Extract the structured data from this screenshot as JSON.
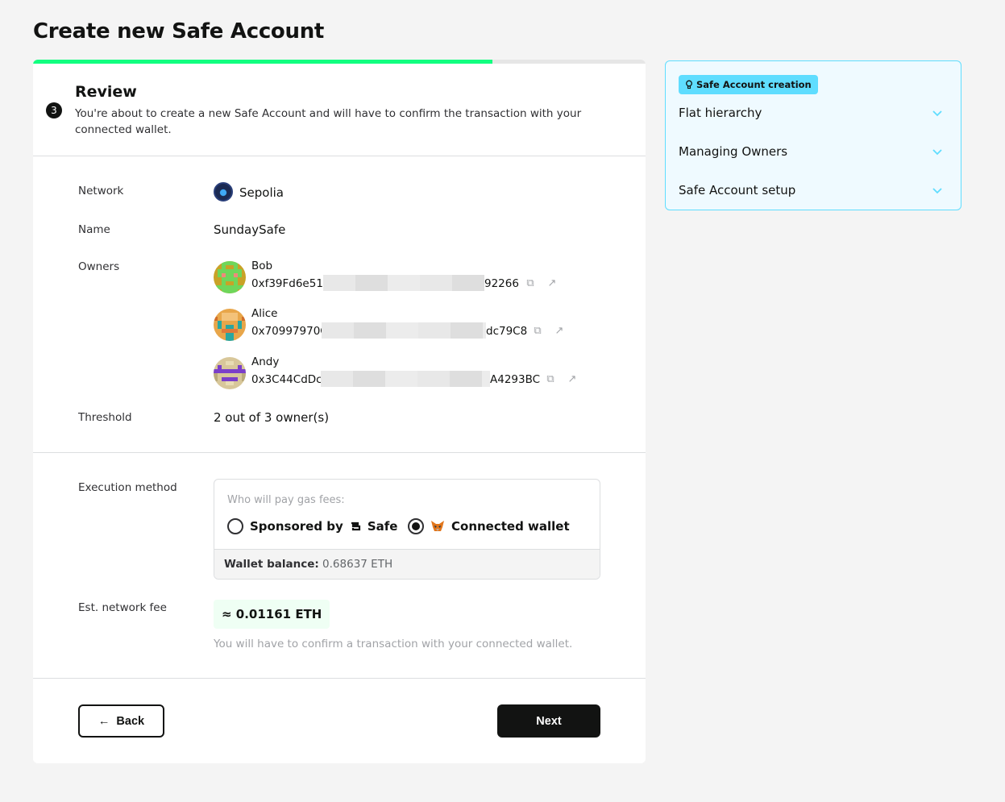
{
  "page": {
    "title": "Create new Safe Account"
  },
  "progress": {
    "fraction": 0.75
  },
  "step": {
    "number": "3",
    "title": "Review",
    "description": "You're about to create a new Safe Account and will have to confirm the transaction with your connected wallet."
  },
  "details": {
    "network_label": "Network",
    "network_value": "Sepolia",
    "name_label": "Name",
    "name_value": "SundaySafe",
    "owners_label": "Owners",
    "owners": [
      {
        "name": "Bob",
        "address_start": "0xf39Fd6e51a",
        "address_end": "92266"
      },
      {
        "name": "Alice",
        "address_start": "0x70997970C",
        "address_end": "dc79C8"
      },
      {
        "name": "Andy",
        "address_start": "0x3C44CdDc",
        "address_end": "A4293BC"
      }
    ],
    "threshold_label": "Threshold",
    "threshold_value": "2 out of 3 owner(s)"
  },
  "execution": {
    "label": "Execution method",
    "question": "Who will pay gas fees:",
    "option_sponsored_prefix": "Sponsored by",
    "option_sponsored_brand": "Safe",
    "option_connected": "Connected wallet",
    "selected": "connected",
    "balance_label": "Wallet balance:",
    "balance_value": " 0.68637 ETH"
  },
  "fee": {
    "label": "Est. network fee",
    "value": "≈ 0.01161 ETH",
    "note": "You will have to confirm a transaction with your connected wallet."
  },
  "actions": {
    "back_label": "Back",
    "next_label": "Next"
  },
  "help": {
    "tag": "Safe Account creation",
    "items": [
      "Flat hierarchy",
      "Managing Owners",
      "Safe Account setup"
    ]
  },
  "colors": {
    "accent_green": "#12ff80",
    "help_border": "#5fddff",
    "help_background": "#effaff"
  }
}
